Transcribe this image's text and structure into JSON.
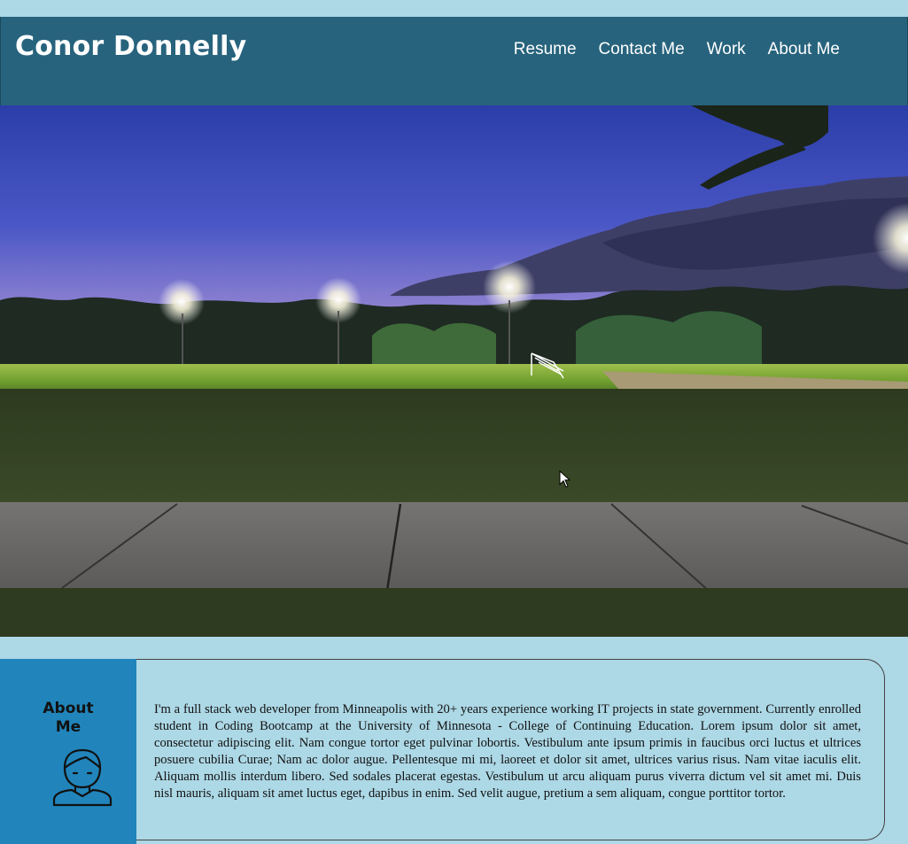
{
  "header": {
    "title": "Conor Donnelly",
    "nav": [
      {
        "label": "Resume"
      },
      {
        "label": "Contact Me"
      },
      {
        "label": "Work"
      },
      {
        "label": "About Me"
      }
    ]
  },
  "about": {
    "heading_line1": "About",
    "heading_line2": "Me",
    "icon": "person-icon",
    "body": "I'm a full stack web developer from Minneapolis with 20+ years experience working IT projects in state government. Currently enrolled student in Coding Bootcamp at the University of Minnesota - College of Continuing Education. Lorem ipsum dolor sit amet, consectetur adipiscing elit. Nam congue tortor eget pulvinar lobortis. Vestibulum ante ipsum primis in faucibus orci luctus et ultrices posuere cubilia Curae; Nam ac dolor augue. Pellentesque mi mi, laoreet et dolor sit amet, ultrices varius risus. Nam vitae iaculis elit. Aliquam mollis interdum libero. Sed sodales placerat egestas. Vestibulum ut arcu aliquam purus viverra dictum vel sit amet mi. Duis nisl mauris, aliquam sit amet luctus eget, dapibus in enim. Sed velit augue, pretium a sem aliquam, congue porttitor tortor."
  },
  "colors": {
    "page_background": "#add8e6",
    "header_background": "#27637d",
    "about_side_background": "#2185bb",
    "header_text": "#ffffff"
  },
  "hero": {
    "description_icon": "soccer-field-night-photo"
  }
}
